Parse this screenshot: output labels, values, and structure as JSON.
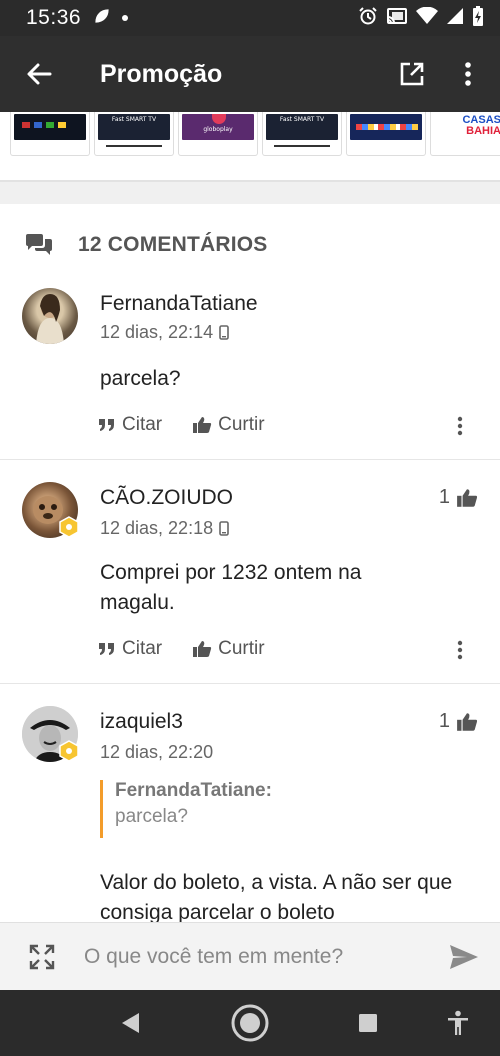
{
  "status_bar": {
    "time": "15:36",
    "icons": [
      "leaf-notification-icon",
      "dot-icon",
      "alarm-icon",
      "cast-icon",
      "wifi-icon",
      "signal-icon",
      "battery-charging-icon"
    ]
  },
  "app_bar": {
    "title": "Promoção",
    "back_icon": "arrow-left-icon",
    "open_external_icon": "open-external-icon",
    "more_icon": "more-vertical-icon"
  },
  "thumbnails": [
    {
      "label": ""
    },
    {
      "label": "Fast SMART TV"
    },
    {
      "label": "globoplay"
    },
    {
      "label": "Fast SMART TV"
    },
    {
      "label": ""
    },
    {
      "brand_line1": "CASAS",
      "brand_line2": "BAHIA"
    }
  ],
  "comments_header": {
    "icon": "comments-icon",
    "title": "12 COMENTÁRIOS"
  },
  "comments": [
    {
      "author": "FernandaTatiane",
      "time": "12 dias, 22:14",
      "device_icon": "mobile-icon",
      "text": "parcela?",
      "likes": "",
      "cite_label": "Citar",
      "like_label": "Curtir"
    },
    {
      "author": "CÃO.ZOIUDO",
      "time": "12 dias, 22:18",
      "device_icon": "mobile-icon",
      "text": "Comprei por 1232 ontem na magalu.",
      "likes": "1",
      "cite_label": "Citar",
      "like_label": "Curtir"
    },
    {
      "author": "izaquiel3",
      "time": "12 dias, 22:20",
      "quote_author": "FernandaTatiane:",
      "quote_text": "parcela?",
      "text": "Valor do boleto, a vista. A não ser que consiga parcelar o boleto",
      "likes": "1"
    }
  ],
  "composer": {
    "placeholder": "O que você tem em mente?",
    "expand_icon": "expand-icon",
    "send_icon": "send-icon"
  },
  "nav_bar": {
    "icons": [
      "back-triangle-icon",
      "home-circle-icon",
      "recents-square-icon",
      "accessibility-icon"
    ]
  },
  "colors": {
    "app_bar": "#2f2f2f",
    "quote_border": "#f39c2a",
    "badge": "#f7c531"
  }
}
